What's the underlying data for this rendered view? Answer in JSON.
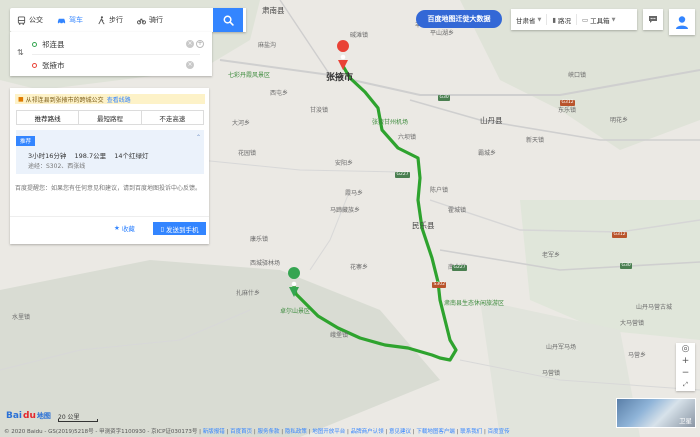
{
  "tabs": [
    {
      "label": "公交",
      "icon": "bus-icon"
    },
    {
      "label": "驾车",
      "icon": "car-icon"
    },
    {
      "label": "步行",
      "icon": "walk-icon"
    },
    {
      "label": "骑行",
      "icon": "bike-icon"
    }
  ],
  "route": {
    "start": "祁连县",
    "end": "张掖市"
  },
  "result": {
    "bus_tip": "从祁连县到张掖市的跨城公交",
    "bus_tip_link": "查看线路",
    "options": [
      "推荐路线",
      "最短路程",
      "不走高速"
    ],
    "plan_tag": "推荐",
    "duration": "3小时16分钟",
    "distance": "198.7公里",
    "lights": "14个红绿灯",
    "via": "途经：S302、西张线",
    "feedback_text": "百度提醒您：如果您有任何意见和建议，请到百度地图投诉中心反馈。",
    "feedback_link": "百度地图投诉中心",
    "fav_label": "收藏",
    "send_label": "发送到手机"
  },
  "top_right": {
    "bigdata": "百度地图迁徙大数据",
    "region": "甘肃省",
    "traffic": "路况",
    "toolbox": "工具箱"
  },
  "map": {
    "cities": {
      "zhangye": "张掖市",
      "qilian": "祁连县",
      "sunan": "肃南县"
    },
    "pois": [
      "七彩丹霞风景区",
      "张掖甘州机场",
      "肃南县生态休闲旅游区",
      "卓尔山景区"
    ],
    "places": [
      "民乐县",
      "山丹县",
      "西屯乡",
      "安阳乡",
      "马蹄藏族乡",
      "扎麻什乡",
      "水里镇",
      "麻盐沟",
      "甘浚镇",
      "平山湖乡",
      "霍城镇",
      "霸城乡",
      "六坝镇",
      "花寨乡",
      "新天镇",
      "南丰镇",
      "大马营镇",
      "老军乡",
      "马营镇",
      "东乐镇",
      "陈户镇",
      "峡口镇",
      "丰城镇",
      "霞马乡",
      "碱滩镇",
      "明花乡",
      "花园镇",
      "大河乡",
      "康乐镇",
      "西城驿林场",
      "山丹军马场",
      "山丹马营古城",
      "马营乡",
      "峨堡镇"
    ],
    "roads": [
      "G30",
      "G30",
      "G312",
      "G312",
      "G227",
      "G227",
      "S302"
    ]
  },
  "footer": {
    "logo": "Bai",
    "logo_red": "du",
    "logo_map": "地图",
    "scale": "20 公里",
    "copyright": "© 2020 Baidu - GS(2019)5218号 - 甲测资字1100930 - 京ICP证030173号",
    "links": [
      "新版报错",
      "百度首页",
      "服务条款",
      "隐私政策",
      "地图开放平台",
      "品牌商户认领",
      "意见建议",
      "下载地图客户端",
      "联系我们",
      "百度宣传"
    ]
  },
  "thumb_label": "卫星",
  "colors": {
    "accent": "#3385ff",
    "route": "#2ea32e",
    "bigdata": "#3368d6"
  }
}
